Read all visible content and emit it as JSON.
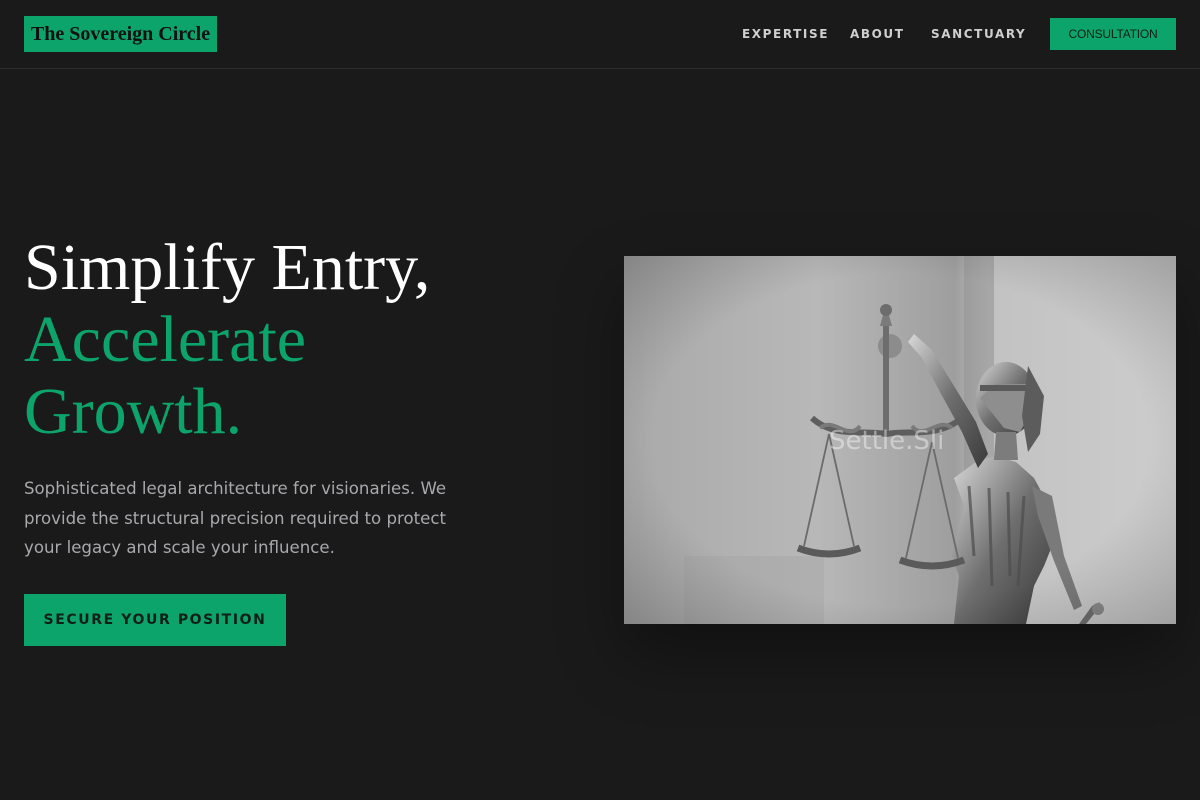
{
  "header": {
    "logo": "The Sovereign Circle",
    "nav": [
      "EXPERTISE",
      "ABOUT",
      "SANCTUARY"
    ],
    "cta": "CONSULTATION"
  },
  "hero": {
    "title_line1": "Simplify Entry,",
    "title_line2": "Accelerate",
    "title_line3": "Growth.",
    "description": "Sophisticated legal architecture for visionaries. We provide the structural precision required to protect your legacy and scale your influence.",
    "cta": "SECURE YOUR POSITION"
  },
  "image": {
    "subject": "lady-justice-statue",
    "overlay_text": "Settle.Sli"
  },
  "colors": {
    "background": "#1a1a1a",
    "accent": "#0ca46b",
    "text": "#ffffff",
    "muted_text": "#a8a8ad"
  }
}
